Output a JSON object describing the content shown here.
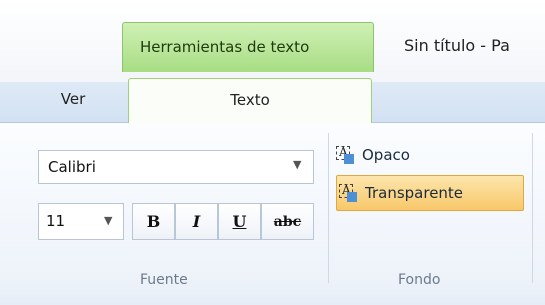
{
  "window": {
    "title": "Sin título - Pa"
  },
  "context_tab_header": "Herramientas de texto",
  "tabs": [
    {
      "label": "Ver",
      "active": false
    },
    {
      "label": "Texto",
      "active": true
    }
  ],
  "font_group": {
    "label": "Fuente",
    "font_family": "Calibri",
    "font_size": "11",
    "bold": "B",
    "italic": "I",
    "underline": "U",
    "strikethrough": "abc"
  },
  "background_group": {
    "label": "Fondo",
    "opaque": "Opaco",
    "transparent": "Transparente",
    "selected": "transparent"
  },
  "colors": {
    "context_green": "#a8dd84",
    "selected_orange": "#f8c86a",
    "tabstrip_blue": "#d2e1f3"
  }
}
